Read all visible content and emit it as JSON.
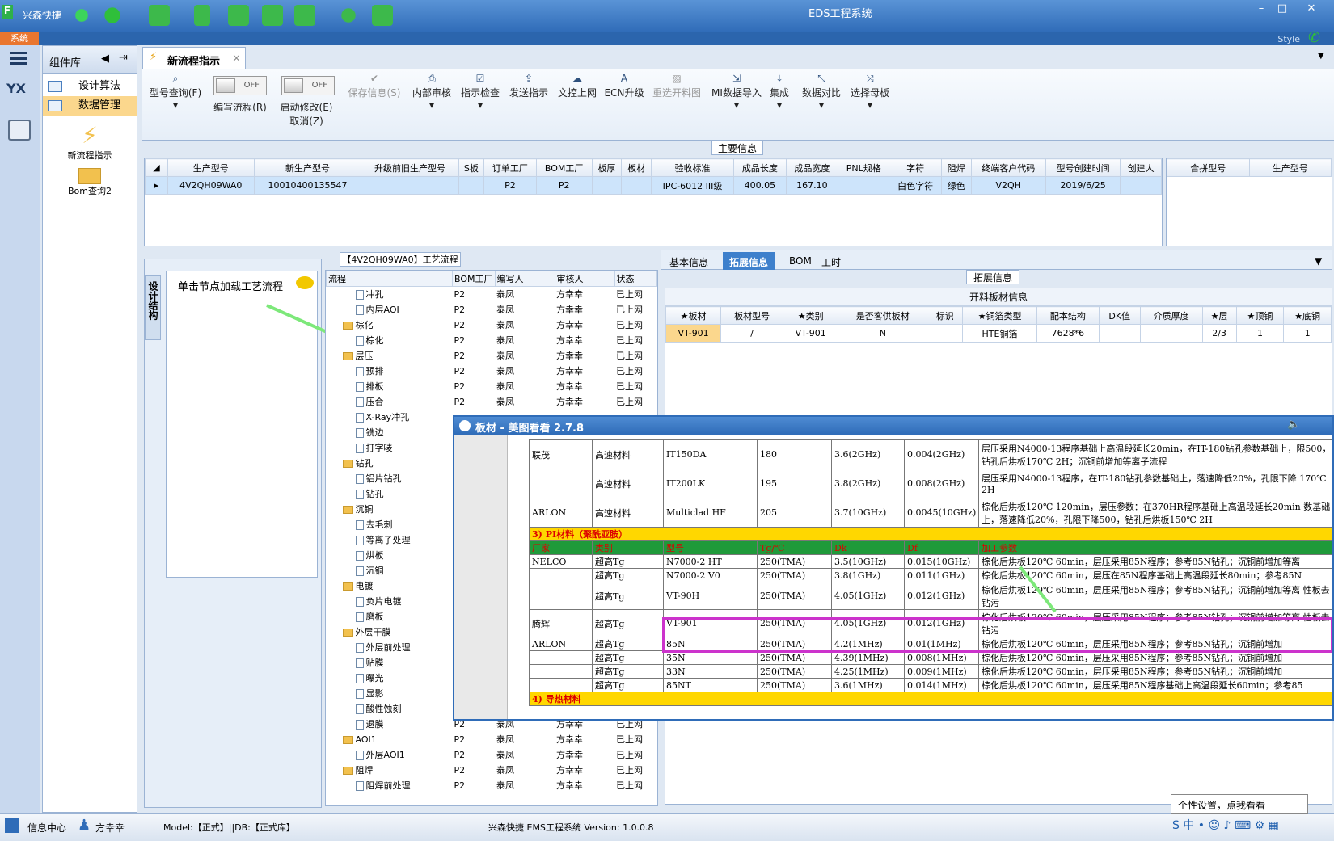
{
  "titlebar": {
    "app": "兴森快捷",
    "title": "EDS工程系统",
    "menu": "系统",
    "style": "Style"
  },
  "component_panel": {
    "title": "组件库",
    "items": [
      "设计算法",
      "数据管理"
    ],
    "big_items": [
      "新流程指示",
      "Bom查询2"
    ]
  },
  "doc_tab": "新流程指示",
  "ribbon": {
    "buttons": [
      "型号查询(F)",
      "编写流程(R)",
      "启动修改(E)",
      "取消(Z)",
      "保存信息(S)",
      "内部审核",
      "指示检查",
      "发送指示",
      "文控上网",
      "ECN升级",
      "重选开料图",
      "MI数据导入",
      "集成",
      "数据对比",
      "选择母板"
    ],
    "off": "OFF"
  },
  "main_info": {
    "title": "主要信息",
    "columns": [
      "生产型号",
      "新生产型号",
      "升级前旧生产型号",
      "S板",
      "订单工厂",
      "BOM工厂",
      "板厚",
      "板材",
      "验收标准",
      "成品长度",
      "成品宽度",
      "PNL规格",
      "字符",
      "阻焊",
      "终端客户代码",
      "型号创建时间",
      "创建人"
    ],
    "row": [
      "4V2QH09WA0",
      "10010400135547",
      "",
      "",
      "P2",
      "P2",
      "",
      "",
      "IPC-6012 III级",
      "400.05",
      "167.10",
      "",
      "白色字符",
      "绿色",
      "V2QH",
      "2019/6/25",
      ""
    ],
    "right_columns": [
      "合拼型号",
      "生产型号"
    ]
  },
  "left_nav": {
    "tab": "设计结构",
    "hint": "单击节点加载工艺流程"
  },
  "flow": {
    "title": "【4V2QH09WA0】工艺流程",
    "columns": [
      "流程",
      "BOM工厂",
      "编写人",
      "审核人",
      "状态"
    ],
    "rows": [
      {
        "name": "冲孔",
        "kind": "doc",
        "indent": 2,
        "bom": "P2",
        "writer": "泰凤",
        "reviewer": "方幸幸",
        "status": "已上网"
      },
      {
        "name": "内层AOI",
        "kind": "doc",
        "indent": 2,
        "bom": "P2",
        "writer": "泰凤",
        "reviewer": "方幸幸",
        "status": "已上网"
      },
      {
        "name": "棕化",
        "kind": "fold",
        "indent": 1,
        "bom": "P2",
        "writer": "泰凤",
        "reviewer": "方幸幸",
        "status": "已上网"
      },
      {
        "name": "棕化",
        "kind": "doc",
        "indent": 2,
        "bom": "P2",
        "writer": "泰凤",
        "reviewer": "方幸幸",
        "status": "已上网"
      },
      {
        "name": "层压",
        "kind": "fold",
        "indent": 1,
        "bom": "P2",
        "writer": "泰凤",
        "reviewer": "方幸幸",
        "status": "已上网"
      },
      {
        "name": "预排",
        "kind": "doc",
        "indent": 2,
        "bom": "P2",
        "writer": "泰凤",
        "reviewer": "方幸幸",
        "status": "已上网"
      },
      {
        "name": "排板",
        "kind": "doc",
        "indent": 2,
        "bom": "P2",
        "writer": "泰凤",
        "reviewer": "方幸幸",
        "status": "已上网"
      },
      {
        "name": "压合",
        "kind": "doc",
        "indent": 2,
        "bom": "P2",
        "writer": "泰凤",
        "reviewer": "方幸幸",
        "status": "已上网"
      },
      {
        "name": "X-Ray冲孔",
        "kind": "doc",
        "indent": 2,
        "bom": "",
        "writer": "",
        "reviewer": "",
        "status": ""
      },
      {
        "name": "铣边",
        "kind": "doc",
        "indent": 2,
        "bom": "",
        "writer": "",
        "reviewer": "",
        "status": ""
      },
      {
        "name": "打字唛",
        "kind": "doc",
        "indent": 2,
        "bom": "",
        "writer": "",
        "reviewer": "",
        "status": ""
      },
      {
        "name": "钻孔",
        "kind": "fold",
        "indent": 1,
        "bom": "",
        "writer": "",
        "reviewer": "",
        "status": ""
      },
      {
        "name": "铝片钻孔",
        "kind": "doc",
        "indent": 2,
        "bom": "",
        "writer": "",
        "reviewer": "",
        "status": ""
      },
      {
        "name": "钻孔",
        "kind": "doc",
        "indent": 2,
        "bom": "",
        "writer": "",
        "reviewer": "",
        "status": ""
      },
      {
        "name": "沉铜",
        "kind": "fold",
        "indent": 1,
        "bom": "",
        "writer": "",
        "reviewer": "",
        "status": ""
      },
      {
        "name": "去毛刺",
        "kind": "doc",
        "indent": 2,
        "bom": "",
        "writer": "",
        "reviewer": "",
        "status": ""
      },
      {
        "name": "等离子处理",
        "kind": "doc",
        "indent": 2,
        "bom": "",
        "writer": "",
        "reviewer": "",
        "status": ""
      },
      {
        "name": "烘板",
        "kind": "doc",
        "indent": 2,
        "bom": "",
        "writer": "",
        "reviewer": "",
        "status": ""
      },
      {
        "name": "沉铜",
        "kind": "doc",
        "indent": 2,
        "bom": "",
        "writer": "",
        "reviewer": "",
        "status": ""
      },
      {
        "name": "电镀",
        "kind": "fold",
        "indent": 1,
        "bom": "",
        "writer": "",
        "reviewer": "",
        "status": ""
      },
      {
        "name": "负片电镀",
        "kind": "doc",
        "indent": 2,
        "bom": "",
        "writer": "",
        "reviewer": "",
        "status": ""
      },
      {
        "name": "磨板",
        "kind": "doc",
        "indent": 2,
        "bom": "",
        "writer": "",
        "reviewer": "",
        "status": ""
      },
      {
        "name": "外层干膜",
        "kind": "fold",
        "indent": 1,
        "bom": "",
        "writer": "",
        "reviewer": "",
        "status": ""
      },
      {
        "name": "外层前处理",
        "kind": "doc",
        "indent": 2,
        "bom": "",
        "writer": "",
        "reviewer": "",
        "status": ""
      },
      {
        "name": "贴膜",
        "kind": "doc",
        "indent": 2,
        "bom": "",
        "writer": "",
        "reviewer": "",
        "status": ""
      },
      {
        "name": "曝光",
        "kind": "doc",
        "indent": 2,
        "bom": "",
        "writer": "",
        "reviewer": "",
        "status": ""
      },
      {
        "name": "显影",
        "kind": "doc",
        "indent": 2,
        "bom": "",
        "writer": "",
        "reviewer": "",
        "status": ""
      },
      {
        "name": "酸性蚀刻",
        "kind": "doc",
        "indent": 2,
        "bom": "",
        "writer": "",
        "reviewer": "",
        "status": ""
      },
      {
        "name": "退膜",
        "kind": "doc",
        "indent": 2,
        "bom": "P2",
        "writer": "泰凤",
        "reviewer": "方幸幸",
        "status": "已上网"
      },
      {
        "name": "AOI1",
        "kind": "fold",
        "indent": 1,
        "bom": "P2",
        "writer": "泰凤",
        "reviewer": "方幸幸",
        "status": "已上网"
      },
      {
        "name": "外层AOI1",
        "kind": "doc",
        "indent": 2,
        "bom": "P2",
        "writer": "泰凤",
        "reviewer": "方幸幸",
        "status": "已上网"
      },
      {
        "name": "阻焊",
        "kind": "fold",
        "indent": 1,
        "bom": "P2",
        "writer": "泰凤",
        "reviewer": "方幸幸",
        "status": "已上网"
      },
      {
        "name": "阻焊前处理",
        "kind": "doc",
        "indent": 2,
        "bom": "P2",
        "writer": "泰凤",
        "reviewer": "方幸幸",
        "status": "已上网"
      }
    ]
  },
  "right_tabs": [
    "基本信息",
    "拓展信息",
    "BOM",
    "工时"
  ],
  "ext_info": {
    "title": "拓展信息",
    "caption": "开料板材信息",
    "columns": [
      "★板材",
      "板材型号",
      "★类别",
      "是否客供板材",
      "标识",
      "★铜箔类型",
      "配本结构",
      "DK值",
      "介质厚度",
      "★层",
      "★顶铜",
      "★底铜"
    ],
    "row": [
      "VT-901",
      "/",
      "VT-901",
      "N",
      "",
      "HTE铜箔",
      "7628*6",
      "",
      "",
      "2/3",
      "1",
      "1"
    ]
  },
  "popup": {
    "title": "板材 - 美图看看 2.7.8",
    "rows_top": [
      [
        "联茂",
        "高速材料",
        "IT150DA",
        "180",
        "3.6(2GHz)",
        "0.004(2GHz)",
        "层压采用N4000-13程序基础上高温段延长20min，在IT-180钻孔参数基础上，限500，钻孔后烘板170℃ 2H；沉铜前增加等离子流程"
      ],
      [
        "",
        "高速材料",
        "IT200LK",
        "195",
        "3.8(2GHz)",
        "0.008(2GHz)",
        "层压采用N4000-13程序，在IT-180钻孔参数基础上，落速降低20%，孔限下降 170℃ 2H"
      ],
      [
        "ARLON",
        "高速材料",
        "Multiclad HF",
        "205",
        "3.7(10GHz)",
        "0.0045(10GHz)",
        "棕化后烘板120℃ 120min，层压参数：在370HR程序基础上高温段延长20min 数基础上，落速降低20%，孔限下降500，钻孔后烘板150℃ 2H"
      ]
    ],
    "section_pi": "3) PI材料（聚酰亚胺）",
    "pi_header": [
      "厂家",
      "类别",
      "型号",
      "Tg/℃",
      "Dk",
      "Df",
      "加工参数"
    ],
    "pi_rows": [
      [
        "NELCO",
        "超高Tg",
        "N7000-2 HT",
        "250(TMA)",
        "3.5(10GHz)",
        "0.015(10GHz)",
        "棕化后烘板120℃ 60min，层压采用85N程序；参考85N钻孔；沉铜前增加等离"
      ],
      [
        "",
        "超高Tg",
        "N7000-2 V0",
        "250(TMA)",
        "3.8(1GHz)",
        "0.011(1GHz)",
        "棕化后烘板120℃ 60min，层压在85N程序基础上高温段延长80min；参考85N"
      ],
      [
        "",
        "超高Tg",
        "VT-90H",
        "250(TMA)",
        "4.05(1GHz)",
        "0.012(1GHz)",
        "棕化后烘板120℃ 60min，层压采用85N程序；参考85N钻孔；沉铜前增加等离 性板去钻污"
      ],
      [
        "腾辉",
        "超高Tg",
        "VT-901",
        "250(TMA)",
        "4.05(1GHz)",
        "0.012(1GHz)",
        "棕化后烘板120℃ 60min，层压采用85N程序；参考85N钻孔；沉铜前增加等离 性板去钻污"
      ],
      [
        "ARLON",
        "超高Tg",
        "85N",
        "250(TMA)",
        "4.2(1MHz)",
        "0.01(1MHz)",
        "棕化后烘板120℃ 60min，层压采用85N程序；参考85N钻孔；沉铜前增加"
      ],
      [
        "",
        "超高Tg",
        "35N",
        "250(TMA)",
        "4.39(1MHz)",
        "0.008(1MHz)",
        "棕化后烘板120℃ 60min，层压采用85N程序；参考85N钻孔；沉铜前增加"
      ],
      [
        "",
        "超高Tg",
        "33N",
        "250(TMA)",
        "4.25(1MHz)",
        "0.009(1MHz)",
        "棕化后烘板120℃ 60min，层压采用85N程序；参考85N钻孔；沉铜前增加"
      ],
      [
        "",
        "超高Tg",
        "85NT",
        "250(TMA)",
        "3.6(1MHz)",
        "0.014(1MHz)",
        "棕化后烘板120℃ 60min，层压采用85N程序基础上高温段延长60min；参考85"
      ]
    ],
    "section_thermal": "4) 导热材料"
  },
  "statusbar": {
    "info_center": "信息中心",
    "user": "方幸幸",
    "model": "Model:【正式】||DB:【正式库】",
    "version": "兴森快捷 EMS工程系统 Version: 1.0.0.8",
    "tooltip": "个性设置，点我看看"
  },
  "colors": {
    "accent": "#2f6cb8",
    "highlight": "#cc33cc",
    "arrow": "#7de87a",
    "selected": "#fbd78d"
  }
}
